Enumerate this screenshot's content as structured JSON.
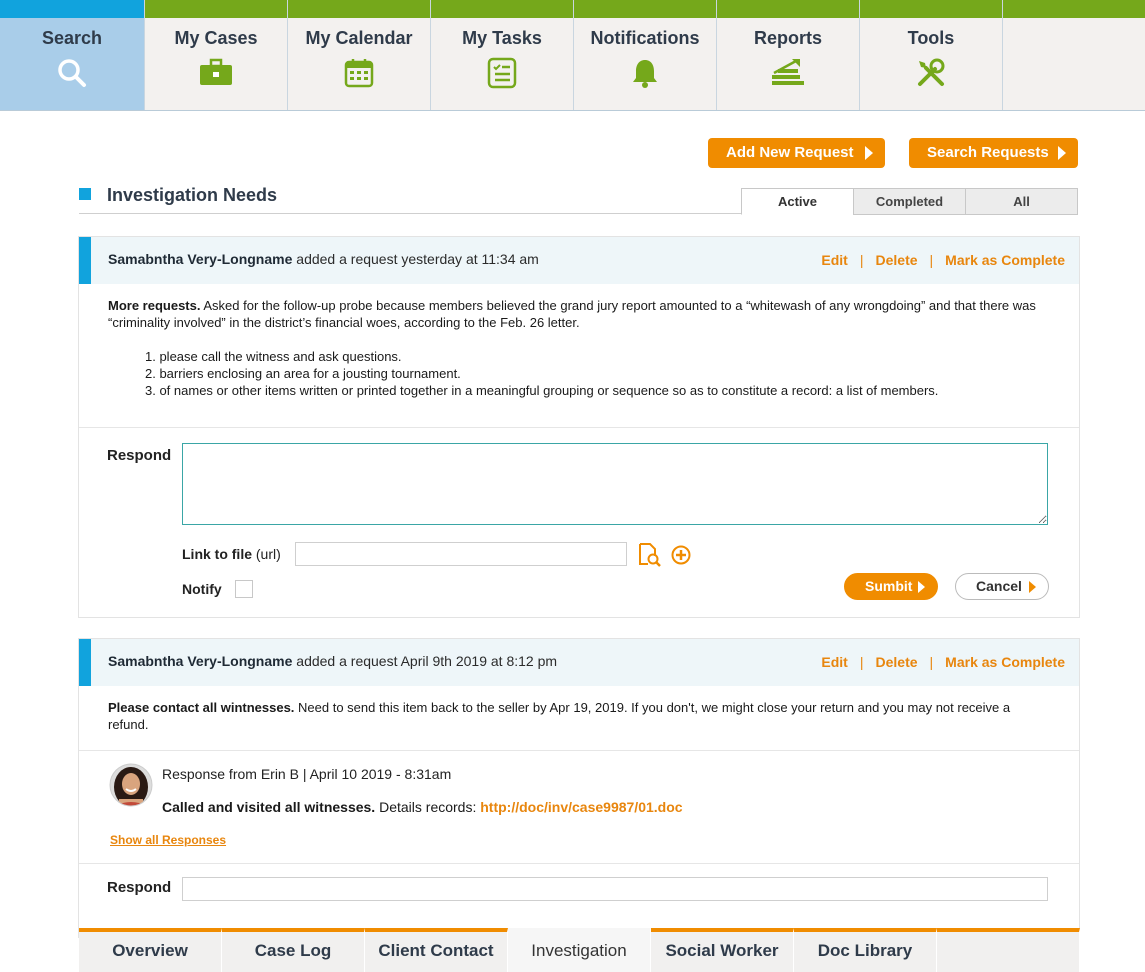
{
  "nav": {
    "tabs": [
      {
        "label": "Search",
        "icon": "search-icon"
      },
      {
        "label": "My Cases",
        "icon": "briefcase-icon"
      },
      {
        "label": "My Calendar",
        "icon": "calendar-icon"
      },
      {
        "label": "My Tasks",
        "icon": "tasks-icon"
      },
      {
        "label": "Notifications",
        "icon": "bell-icon"
      },
      {
        "label": "Reports",
        "icon": "chart-icon"
      },
      {
        "label": "Tools",
        "icon": "tools-icon"
      }
    ],
    "active_color": "#11a3dd",
    "accent_color": "#75a81b"
  },
  "actions": {
    "add_new": "Add New Request",
    "search": "Search Requests"
  },
  "section": {
    "title": "Investigation Needs",
    "filters": [
      "Active",
      "Completed",
      "All"
    ]
  },
  "card_actions": {
    "edit": "Edit",
    "delete": "Delete",
    "complete": "Mark as Complete",
    "sep": "|"
  },
  "request1": {
    "author": "Samabntha Very-Longname",
    "meta": " added a request yesterday at 11:34 am",
    "lead": "More requests.",
    "text": "  Asked for the follow-up probe because members believed the grand jury report amounted to a “whitewash of any wrongdoing” and that there was “criminality involved” in the district’s financial woes, according to the Feb. 26 letter.",
    "items": [
      "1. please call the witness and ask questions.",
      "2. barriers enclosing an area for a jousting tournament.",
      "3. of names or other items written or printed together in a meaningful grouping or sequence so as to constitute a record: a list of members."
    ],
    "respond_label": "Respond",
    "link_label": "Link to file",
    "link_hint": " (url)",
    "notify_label": "Notify",
    "submit": "Sumbit",
    "cancel": "Cancel"
  },
  "request2": {
    "author": "Samabntha Very-Longname",
    "meta": " added a request April 9th 2019 at 8:12 pm",
    "lead": "Please contact all wintnesses.",
    "text": " Need to send this item back to the seller by Apr 19, 2019. If you don't, we might close your return and you may not receive a refund.",
    "response": {
      "header": "Response from Erin B  |  April 10 2019 - 8:31am",
      "lead": "Called and visited all witnesses.",
      "text": " Details records: ",
      "link": "http://doc/inv/case9987/01.doc"
    },
    "show_all": "Show all Responses",
    "respond_label": "Respond"
  },
  "bottom_tabs": [
    "Overview",
    "Case Log",
    "Client Contact",
    "Investigation",
    "Social Worker",
    "Doc Library"
  ]
}
